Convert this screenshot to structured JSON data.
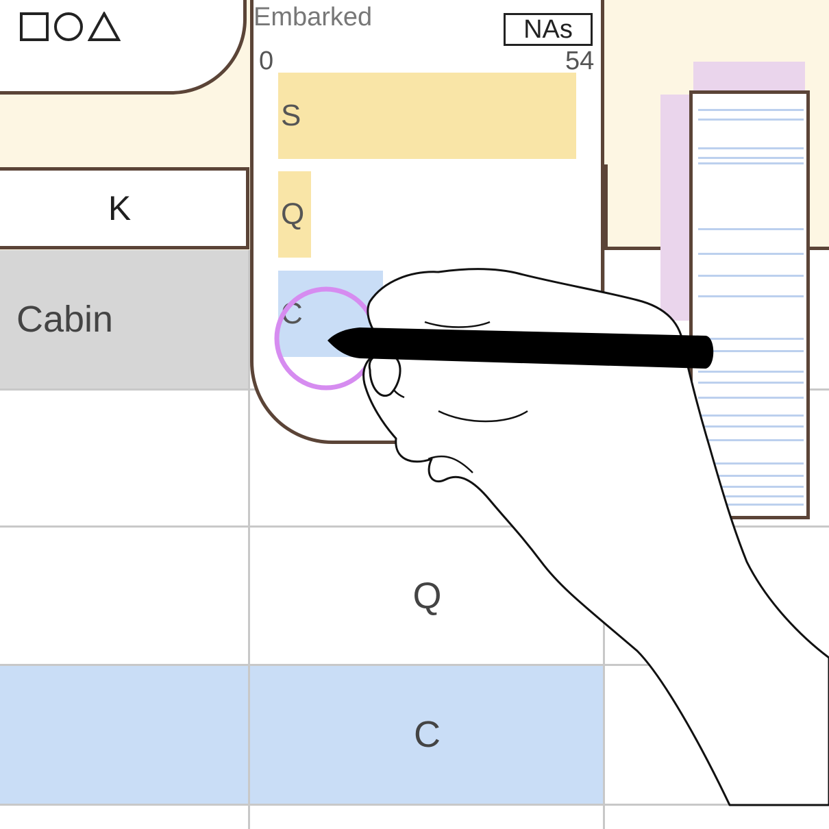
{
  "toolbar": {
    "shape_icons": [
      "square-icon",
      "circle-icon",
      "triangle-icon"
    ]
  },
  "table": {
    "header": {
      "column_k": "K"
    },
    "rows": [
      {
        "col1": "Cabin",
        "col2": "",
        "bg": "#d6d6d6"
      },
      {
        "col1": "",
        "col2": "",
        "bg": "#ffffff"
      },
      {
        "col1": "",
        "col2": "Q",
        "bg": "#ffffff"
      },
      {
        "col1": "",
        "col2": "C",
        "bg": "#c9ddf6"
      }
    ]
  },
  "embarked_popup": {
    "title": "Embarked",
    "nas_button": "NAs",
    "axis_min": "0",
    "axis_max": "54",
    "bars": [
      {
        "label": "S",
        "value": 54,
        "color": "#f9e5a7"
      },
      {
        "label": "Q",
        "value": 6,
        "color": "#f9e5a7"
      },
      {
        "label": "C",
        "value": 19,
        "color": "#c9ddf6"
      }
    ]
  },
  "colors": {
    "header_bg": "#fdf6e3",
    "border": "#5b4437",
    "highlight_row": "#c9ddf6",
    "selected_row": "#d6d6d6",
    "cursor_ring": "#d68cf0"
  }
}
